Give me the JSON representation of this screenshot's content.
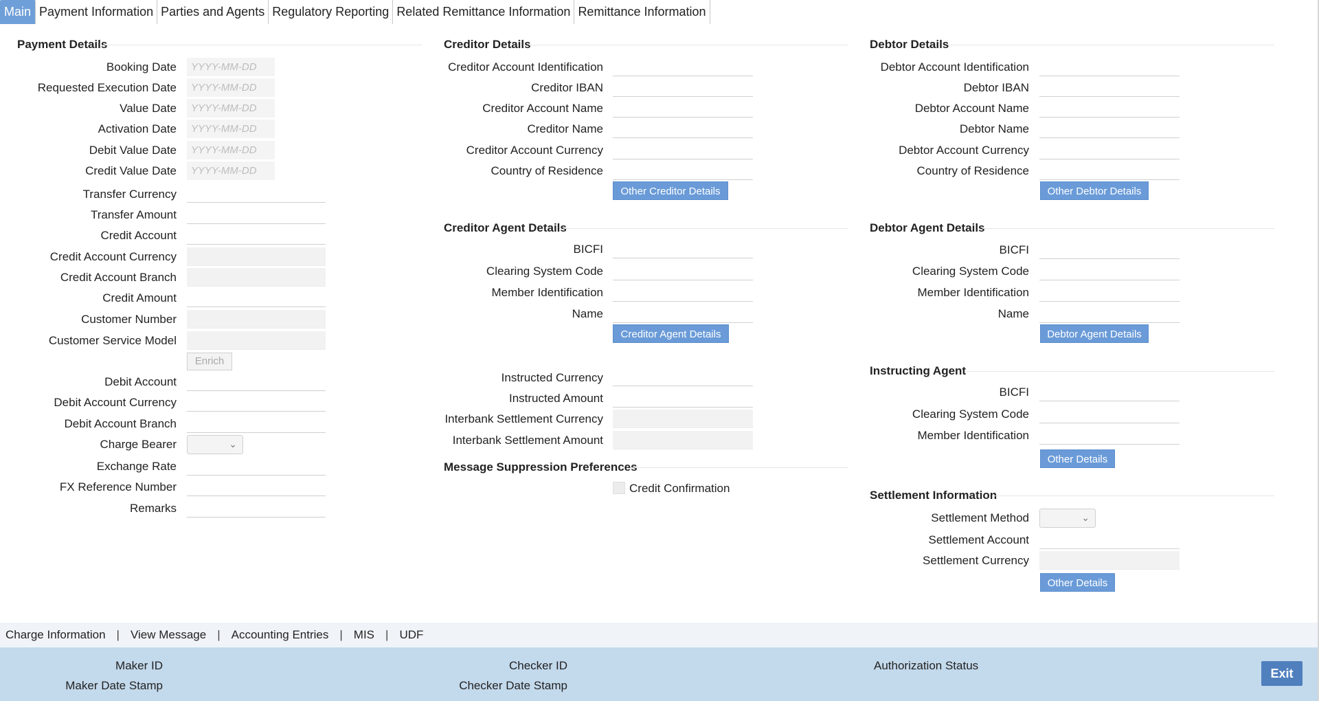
{
  "tabs": [
    {
      "label": "Main"
    },
    {
      "label": "Payment Information"
    },
    {
      "label": "Parties and Agents"
    },
    {
      "label": "Regulatory Reporting"
    },
    {
      "label": "Related Remittance Information"
    },
    {
      "label": "Remittance Information"
    }
  ],
  "payment": {
    "title": "Payment Details",
    "date_placeholder": "YYYY-MM-DD",
    "booking_date": "Booking Date",
    "requested_execution_date": "Requested Execution Date",
    "value_date": "Value Date",
    "activation_date": "Activation Date",
    "debit_value_date": "Debit Value Date",
    "credit_value_date": "Credit Value Date",
    "transfer_currency": "Transfer Currency",
    "transfer_amount": "Transfer Amount",
    "credit_account": "Credit Account",
    "credit_account_currency": "Credit Account Currency",
    "credit_account_branch": "Credit Account Branch",
    "credit_amount": "Credit Amount",
    "customer_number": "Customer Number",
    "customer_service_model": "Customer Service Model",
    "enrich": "Enrich",
    "debit_account": "Debit Account",
    "debit_account_currency": "Debit Account Currency",
    "debit_account_branch": "Debit Account Branch",
    "charge_bearer": "Charge Bearer",
    "exchange_rate": "Exchange Rate",
    "fx_reference_number": "FX Reference Number",
    "remarks": "Remarks"
  },
  "creditor": {
    "title": "Creditor Details",
    "account_identification": "Creditor Account Identification",
    "iban": "Creditor IBAN",
    "account_name": "Creditor Account Name",
    "name": "Creditor Name",
    "account_currency": "Creditor Account Currency",
    "country_of_residence": "Country of Residence",
    "other_button": "Other Creditor Details"
  },
  "creditor_agent": {
    "title": "Creditor Agent Details",
    "bicfi": "BICFI",
    "clearing_system_code": "Clearing System Code",
    "member_identification": "Member Identification",
    "name": "Name",
    "button": "Creditor Agent Details"
  },
  "instructed": {
    "instructed_currency": "Instructed Currency",
    "instructed_amount": "Instructed Amount",
    "interbank_settlement_currency": "Interbank Settlement Currency",
    "interbank_settlement_amount": "Interbank Settlement Amount"
  },
  "suppression": {
    "title": "Message Suppression Preferences",
    "credit_confirmation": "Credit Confirmation"
  },
  "debtor": {
    "title": "Debtor Details",
    "account_identification": "Debtor Account Identification",
    "iban": "Debtor IBAN",
    "account_name": "Debtor Account Name",
    "name": "Debtor Name",
    "account_currency": "Debtor Account Currency",
    "country_of_residence": "Country of Residence",
    "other_button": "Other Debtor Details"
  },
  "debtor_agent": {
    "title": "Debtor Agent Details",
    "bicfi": "BICFI",
    "clearing_system_code": "Clearing System Code",
    "member_identification": "Member Identification",
    "name": "Name",
    "button": "Debtor Agent Details"
  },
  "instructing_agent": {
    "title": "Instructing Agent",
    "bicfi": "BICFI",
    "clearing_system_code": "Clearing System Code",
    "member_identification": "Member Identification",
    "button": "Other Details"
  },
  "settlement": {
    "title": "Settlement Information",
    "method": "Settlement Method",
    "account": "Settlement Account",
    "currency": "Settlement Currency",
    "button": "Other Details"
  },
  "links": [
    "Charge Information",
    "View Message",
    "Accounting Entries",
    "MIS",
    "UDF"
  ],
  "link_separator": "|",
  "footer": {
    "maker_id": "Maker ID",
    "maker_date_stamp": "Maker Date Stamp",
    "checker_id": "Checker ID",
    "checker_date_stamp": "Checker Date Stamp",
    "authorization_status": "Authorization Status",
    "exit": "Exit"
  },
  "colors": {
    "tab_active": "#6f9fd8",
    "button_blue": "#6a9bd8",
    "footer_bg": "#c3d9ec",
    "exit_bg": "#4f7fbd"
  }
}
